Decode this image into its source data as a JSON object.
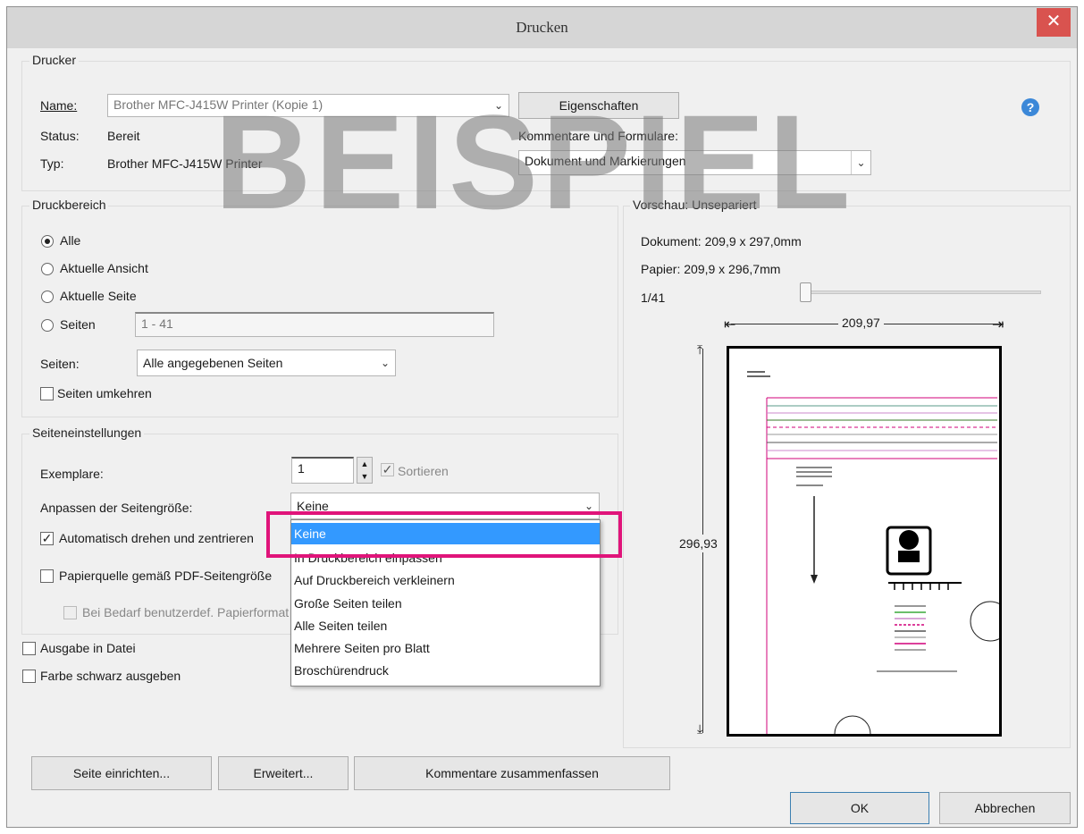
{
  "window": {
    "title": "Drucken",
    "close_glyph": "✕"
  },
  "watermark": "BEISPIEL",
  "printer": {
    "group_label": "Drucker",
    "name_label": "Name:",
    "name_value": "Brother MFC-J415W Printer (Kopie 1)",
    "status_label": "Status:",
    "status_value": "Bereit",
    "type_label": "Typ:",
    "type_value": "Brother MFC-J415W Printer",
    "properties_button": "Eigenschaften",
    "comments_label": "Kommentare und Formulare:",
    "comments_value": "Dokument und Markierungen",
    "help_glyph": "?"
  },
  "range": {
    "group_label": "Druckbereich",
    "options": [
      "Alle",
      "Aktuelle Ansicht",
      "Aktuelle Seite",
      "Seiten"
    ],
    "pages_value": "1 - 41",
    "subset_label": "Seiten:",
    "subset_value": "Alle angegebenen Seiten",
    "reverse_label": "Seiten umkehren"
  },
  "page_setup": {
    "group_label": "Seiteneinstellungen",
    "copies_label": "Exemplare:",
    "copies_value": "1",
    "collate_label": "Sortieren",
    "scaling_label": "Anpassen der Seitengröße:",
    "scaling_value": "Keine",
    "auto_rotate_label": "Automatisch drehen und zentrieren",
    "paper_source_label": "Papierquelle gemäß PDF-Seitengröße",
    "custom_paper_label": "Bei Bedarf benutzerdef. Papierformat"
  },
  "scaling_options": [
    "Keine",
    "In Druckbereich einpassen",
    "Auf Druckbereich verkleinern",
    "Große Seiten teilen",
    "Alle Seiten teilen",
    "Mehrere Seiten pro Blatt",
    "Broschürendruck"
  ],
  "output": {
    "to_file_label": "Ausgabe in Datei",
    "black_label": "Farbe schwarz ausgeben"
  },
  "preview": {
    "group_label": "Vorschau: Unsepariert",
    "document_size": "Dokument: 209,9 x 297,0mm",
    "paper_size": "Papier: 209,9 x 296,7mm",
    "page_counter": "1/41",
    "width_label": "209,97",
    "height_label": "296,93"
  },
  "buttons": {
    "page_setup": "Seite einrichten...",
    "advanced": "Erweitert...",
    "summarize": "Kommentare zusammenfassen",
    "ok": "OK",
    "cancel": "Abbrechen"
  }
}
